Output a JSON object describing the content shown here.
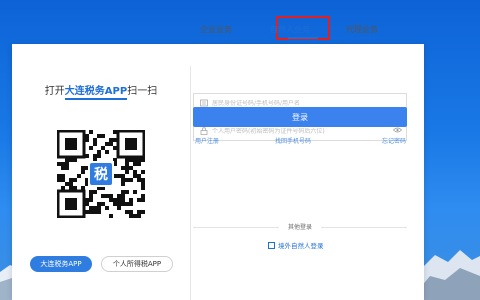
{
  "left": {
    "scan_prefix": "打开",
    "scan_app": "大连税务APP",
    "scan_suffix": "扫一扫",
    "app_buttons": [
      "大连税务APP",
      "个人所得税APP"
    ],
    "qr_logo_char": "税"
  },
  "tabs": [
    "企业业务",
    "自然人业务",
    "代理业务"
  ],
  "active_tab_index": 1,
  "form": {
    "account_placeholder": "居民身份证号码/手机号码/用户名",
    "password_placeholder": "个人用户密码(初始密码为证件号码后六位)",
    "login_label": "登录",
    "links": [
      "用户注册",
      "找回手机号码",
      "忘记密码"
    ]
  },
  "other": {
    "title": "其他登录",
    "link": "境外自然人登录"
  },
  "colors": {
    "primary": "#3b82ee",
    "link": "#4a8ae0",
    "highlight_box": "#e02020"
  },
  "icons": [
    "user-id-icon",
    "lock-icon",
    "eye-icon",
    "overseas-login-icon"
  ]
}
